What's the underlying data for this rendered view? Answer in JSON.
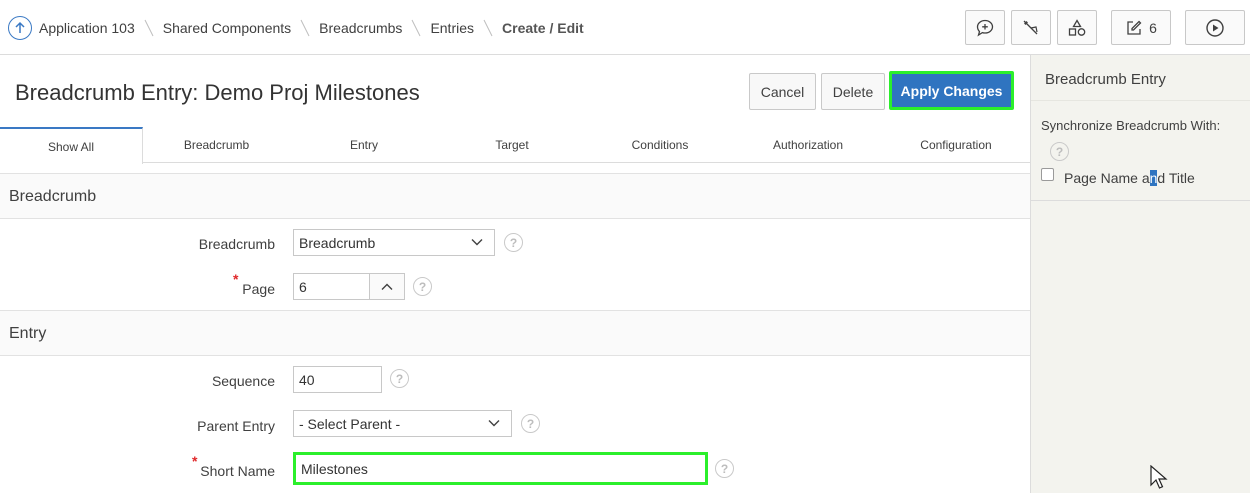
{
  "breadcrumb": {
    "items": [
      "Application 103",
      "Shared Components",
      "Breadcrumbs",
      "Entries"
    ],
    "current": "Create / Edit"
  },
  "toolbar": {
    "comment_icon": "comment-plus-icon",
    "debug_icon": "bug-icon",
    "shapes_icon": "shapes-icon",
    "edit_icon": "edit-icon",
    "edit_count": "6",
    "run_icon": "play-icon"
  },
  "page": {
    "title": "Breadcrumb Entry: Demo Proj Milestones",
    "cancel_label": "Cancel",
    "delete_label": "Delete",
    "apply_label": "Apply Changes"
  },
  "tabs": [
    {
      "label": "Show All"
    },
    {
      "label": "Breadcrumb"
    },
    {
      "label": "Entry"
    },
    {
      "label": "Target"
    },
    {
      "label": "Conditions"
    },
    {
      "label": "Authorization"
    },
    {
      "label": "Configuration"
    }
  ],
  "regions": {
    "breadcrumb": {
      "title": "Breadcrumb",
      "breadcrumb_label": "Breadcrumb",
      "breadcrumb_value": "Breadcrumb",
      "page_label": "Page",
      "page_value": "6"
    },
    "entry": {
      "title": "Entry",
      "sequence_label": "Sequence",
      "sequence_value": "40",
      "parent_label": "Parent Entry",
      "parent_value": "- Select Parent -",
      "short_name_label": "Short Name",
      "short_name_value": "Milestones"
    }
  },
  "required_marker": "*",
  "help_glyph": "?",
  "side_panel": {
    "title": "Breadcrumb Entry",
    "sync_label": "Synchronize Breadcrumb With:",
    "checkbox_label_pre": "Page Name a",
    "checkbox_label_sel": "n",
    "checkbox_label_post": "d Title"
  },
  "colors": {
    "accent": "#2f74c0",
    "highlight": "#2bef2b",
    "required": "#e0282a",
    "side_bg": "#f3f3ee"
  }
}
